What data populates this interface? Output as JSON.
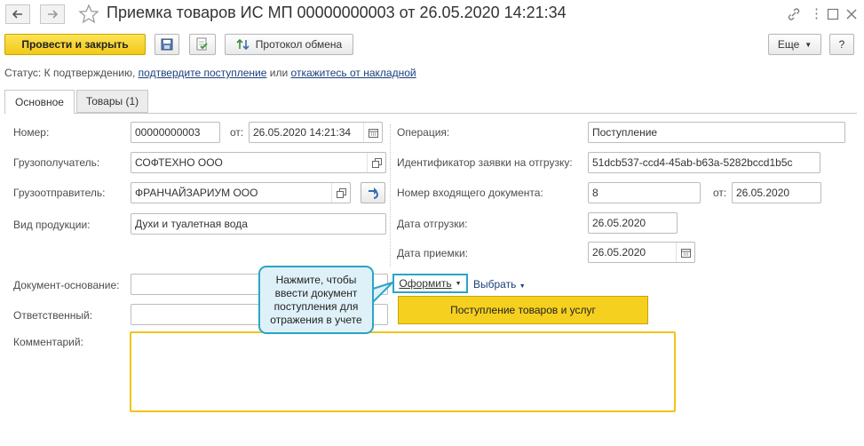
{
  "window": {
    "title": "Приемка товаров ИС МП 00000000003 от 26.05.2020 14:21:34",
    "back_icon": "arrow-left-icon",
    "forward_icon": "arrow-right-icon",
    "star_icon": "star-icon"
  },
  "toolbar": {
    "post_close_label": "Провести и закрыть",
    "protocol_label": "Протокол обмена",
    "more_label": "Еще",
    "help_label": "?"
  },
  "status": {
    "prefix": "Статус:",
    "text": "К подтверждению,",
    "confirm_link": "подтвердите поступление",
    "or": "или",
    "reject_link": "откажитесь от накладной"
  },
  "tabs": [
    {
      "label": "Основное"
    },
    {
      "label": "Товары (1)"
    }
  ],
  "form": {
    "number_label": "Номер:",
    "number_value": "00000000003",
    "from_label": "от:",
    "date_value": "26.05.2020 14:21:34",
    "consignee_label": "Грузополучатель:",
    "consignee_value": "СОФТЕХНО ООО",
    "shipper_label": "Грузоотправитель:",
    "shipper_value": "ФРАНЧАЙЗАРИУМ ООО",
    "product_type_label": "Вид продукции:",
    "product_type_value": "Духи и туалетная вода",
    "operation_label": "Операция:",
    "operation_value": "Поступление",
    "shipment_request_label": "Идентификатор заявки на отгрузку:",
    "shipment_request_value": "51dcb537-ccd4-45ab-b63a-5282bccd1b5c",
    "incoming_doc_label": "Номер входящего документа:",
    "incoming_doc_value": "8",
    "incoming_from_label": "от:",
    "incoming_date_value": "26.05.2020",
    "ship_date_label": "Дата отгрузки:",
    "ship_date_value": "26.05.2020",
    "accept_date_label": "Дата приемки:",
    "accept_date_value": "26.05.2020",
    "base_doc_label": "Документ-основание:",
    "base_doc_value": "",
    "responsible_label": "Ответственный:",
    "responsible_value": "",
    "comment_label": "Комментарий:",
    "comment_value": ""
  },
  "actions": {
    "create_label": "Оформить",
    "select_label": "Выбрать",
    "receipt_menu_item": "Поступление товаров и услуг"
  },
  "tooltip": {
    "text": "Нажмите, чтобы ввести документ поступления для отражения в учете"
  },
  "colors": {
    "accent_yellow": "#f5d01f",
    "link_blue": "#1b3f7d",
    "tooltip_border": "#2aa6c4",
    "tooltip_fill": "#dff1f8"
  }
}
